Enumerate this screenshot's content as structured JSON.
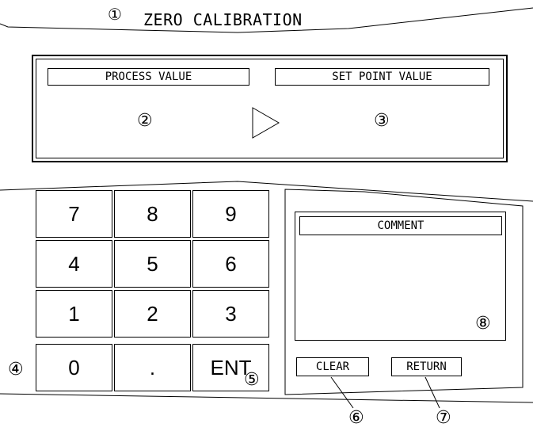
{
  "header": {
    "marker": "①",
    "title": "ZERO CALIBRATION"
  },
  "display_panel": {
    "process_value_label": "PROCESS VALUE",
    "set_point_value_label": "SET POINT VALUE",
    "process_value_marker": "②",
    "set_point_value_marker": "③",
    "arrow_icon": "triangle-right-icon"
  },
  "keypad": {
    "keys": [
      "7",
      "8",
      "9",
      "4",
      "5",
      "6",
      "1",
      "2",
      "3",
      "0",
      ".",
      "ENT"
    ],
    "keypad_marker": "④",
    "enter_marker": "⑤"
  },
  "comment": {
    "label": "COMMENT",
    "marker": "⑧"
  },
  "buttons": {
    "clear_label": "CLEAR",
    "return_label": "RETURN",
    "clear_marker": "⑥",
    "return_marker": "⑦"
  }
}
